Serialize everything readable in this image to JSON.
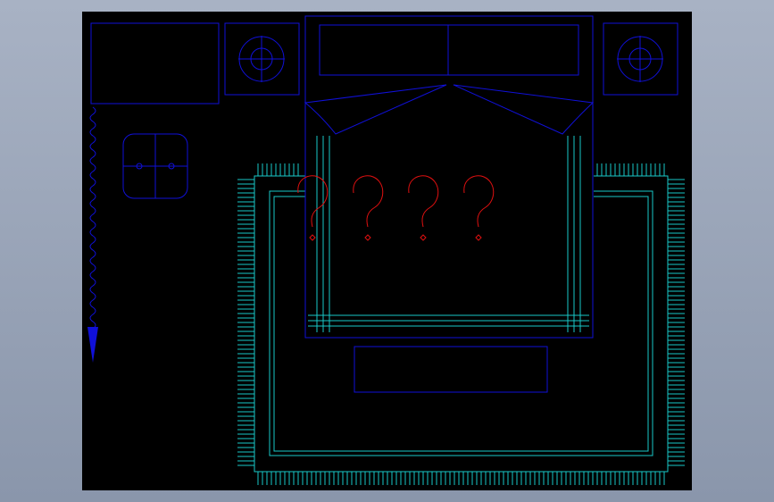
{
  "viewport": {
    "background": "#000000",
    "window_background": "#98a3b7"
  },
  "colors": {
    "furniture": "#1010d8",
    "rug": "#19c8c8",
    "annotation": "#e01010"
  },
  "annotation": {
    "text": "????"
  },
  "icons": {
    "direction_arrow": "wavy-down-arrow-icon"
  }
}
